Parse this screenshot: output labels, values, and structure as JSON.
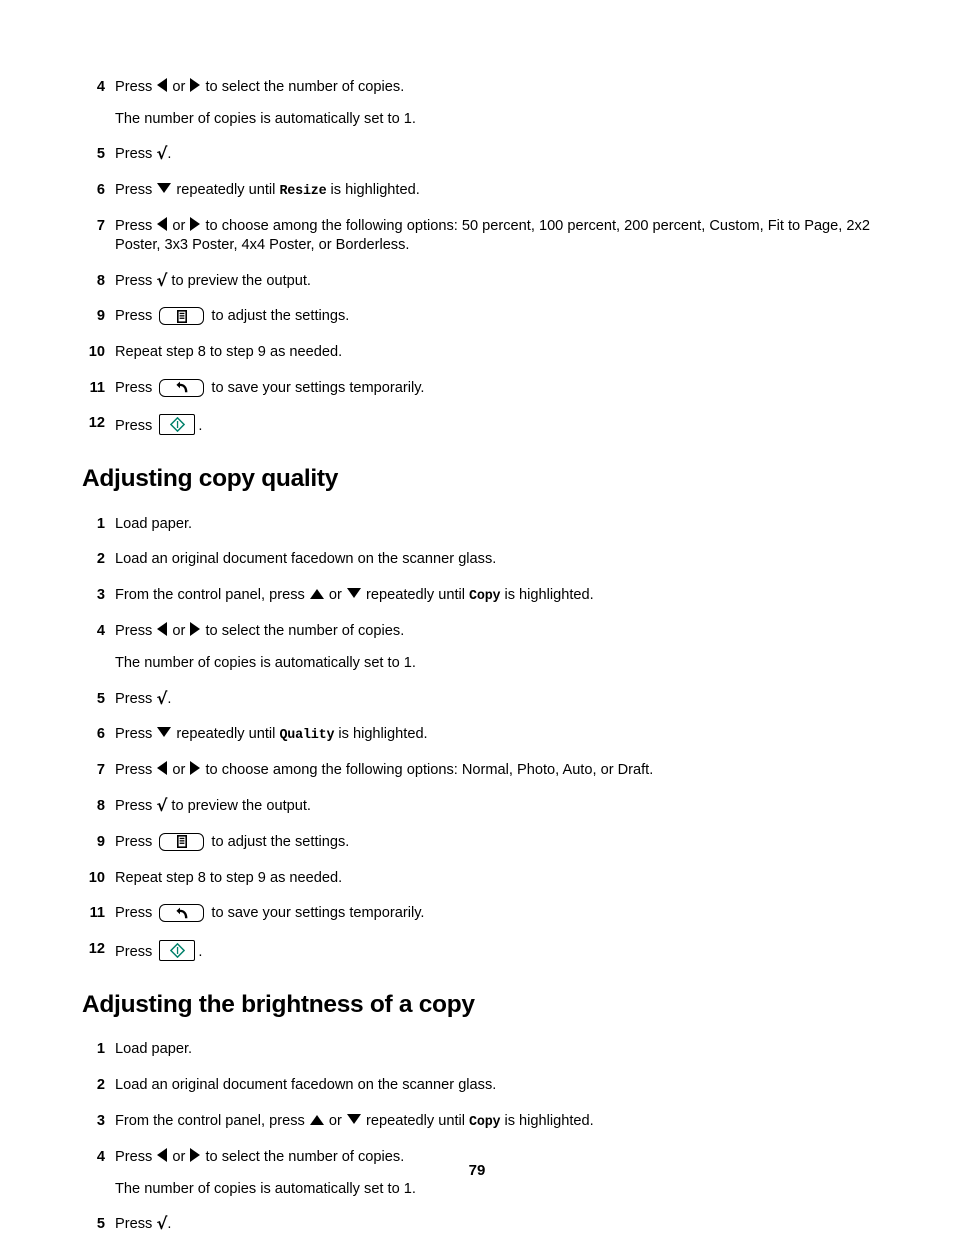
{
  "document": {
    "page_number": "79",
    "accent_color": "#00806a"
  },
  "icons": {
    "left_arrow": "left-triangle-icon",
    "right_arrow": "right-triangle-icon",
    "up_arrow": "up-triangle-icon",
    "down_arrow": "down-triangle-icon",
    "check": "check-icon",
    "settings_key": "settings-key-icon",
    "back_key": "back-key-icon",
    "start_key": "start-key-icon"
  },
  "sections": [
    {
      "id": "continued-steps",
      "heading": null,
      "steps": [
        {
          "num": "4",
          "parts": [
            {
              "t": "text",
              "v": "Press "
            },
            {
              "t": "icon",
              "v": "left_arrow"
            },
            {
              "t": "text",
              "v": " or "
            },
            {
              "t": "icon",
              "v": "right_arrow"
            },
            {
              "t": "text",
              "v": " to select the number of copies."
            }
          ],
          "note": "The number of copies is automatically set to 1."
        },
        {
          "num": "5",
          "parts": [
            {
              "t": "text",
              "v": "Press "
            },
            {
              "t": "icon",
              "v": "check"
            },
            {
              "t": "text",
              "v": "."
            }
          ]
        },
        {
          "num": "6",
          "parts": [
            {
              "t": "text",
              "v": "Press "
            },
            {
              "t": "icon",
              "v": "down_arrow"
            },
            {
              "t": "text",
              "v": " repeatedly until "
            },
            {
              "t": "mono",
              "v": "Resize"
            },
            {
              "t": "text",
              "v": " is highlighted."
            }
          ]
        },
        {
          "num": "7",
          "parts": [
            {
              "t": "text",
              "v": "Press "
            },
            {
              "t": "icon",
              "v": "left_arrow"
            },
            {
              "t": "text",
              "v": " or "
            },
            {
              "t": "icon",
              "v": "right_arrow"
            },
            {
              "t": "text",
              "v": " to choose among the following options: 50 percent, 100 percent, 200 percent, Custom, Fit to Page, 2x2 Poster, 3x3 Poster, 4x4 Poster, or Borderless."
            }
          ]
        },
        {
          "num": "8",
          "parts": [
            {
              "t": "text",
              "v": "Press "
            },
            {
              "t": "icon",
              "v": "check"
            },
            {
              "t": "text",
              "v": " to preview the output."
            }
          ]
        },
        {
          "num": "9",
          "parts": [
            {
              "t": "text",
              "v": "Press "
            },
            {
              "t": "key",
              "v": "settings_key"
            },
            {
              "t": "text",
              "v": " to adjust the settings."
            }
          ]
        },
        {
          "num": "10",
          "parts": [
            {
              "t": "text",
              "v": "Repeat step 8 to step 9 as needed."
            }
          ]
        },
        {
          "num": "11",
          "parts": [
            {
              "t": "text",
              "v": "Press "
            },
            {
              "t": "key",
              "v": "back_key"
            },
            {
              "t": "text",
              "v": " to save your settings temporarily."
            }
          ]
        },
        {
          "num": "12",
          "parts": [
            {
              "t": "text",
              "v": "Press "
            },
            {
              "t": "key",
              "v": "start_key"
            },
            {
              "t": "text",
              "v": "."
            }
          ]
        }
      ]
    },
    {
      "id": "adjusting-copy-quality",
      "heading": "Adjusting copy quality",
      "steps": [
        {
          "num": "1",
          "parts": [
            {
              "t": "text",
              "v": "Load paper."
            }
          ]
        },
        {
          "num": "2",
          "parts": [
            {
              "t": "text",
              "v": "Load an original document facedown on the scanner glass."
            }
          ]
        },
        {
          "num": "3",
          "parts": [
            {
              "t": "text",
              "v": "From the control panel, press "
            },
            {
              "t": "icon",
              "v": "up_arrow"
            },
            {
              "t": "text",
              "v": " or "
            },
            {
              "t": "icon",
              "v": "down_arrow"
            },
            {
              "t": "text",
              "v": " repeatedly until "
            },
            {
              "t": "mono",
              "v": "Copy"
            },
            {
              "t": "text",
              "v": " is highlighted."
            }
          ]
        },
        {
          "num": "4",
          "parts": [
            {
              "t": "text",
              "v": "Press "
            },
            {
              "t": "icon",
              "v": "left_arrow"
            },
            {
              "t": "text",
              "v": " or "
            },
            {
              "t": "icon",
              "v": "right_arrow"
            },
            {
              "t": "text",
              "v": " to select the number of copies."
            }
          ],
          "note": "The number of copies is automatically set to 1."
        },
        {
          "num": "5",
          "parts": [
            {
              "t": "text",
              "v": "Press "
            },
            {
              "t": "icon",
              "v": "check"
            },
            {
              "t": "text",
              "v": "."
            }
          ]
        },
        {
          "num": "6",
          "parts": [
            {
              "t": "text",
              "v": "Press "
            },
            {
              "t": "icon",
              "v": "down_arrow"
            },
            {
              "t": "text",
              "v": " repeatedly until "
            },
            {
              "t": "mono",
              "v": "Quality"
            },
            {
              "t": "text",
              "v": " is highlighted."
            }
          ]
        },
        {
          "num": "7",
          "parts": [
            {
              "t": "text",
              "v": "Press "
            },
            {
              "t": "icon",
              "v": "left_arrow"
            },
            {
              "t": "text",
              "v": " or "
            },
            {
              "t": "icon",
              "v": "right_arrow"
            },
            {
              "t": "text",
              "v": " to choose among the following options: Normal, Photo, Auto, or Draft."
            }
          ]
        },
        {
          "num": "8",
          "parts": [
            {
              "t": "text",
              "v": "Press "
            },
            {
              "t": "icon",
              "v": "check"
            },
            {
              "t": "text",
              "v": " to preview the output."
            }
          ]
        },
        {
          "num": "9",
          "parts": [
            {
              "t": "text",
              "v": "Press "
            },
            {
              "t": "key",
              "v": "settings_key"
            },
            {
              "t": "text",
              "v": " to adjust the settings."
            }
          ]
        },
        {
          "num": "10",
          "parts": [
            {
              "t": "text",
              "v": "Repeat step 8 to step 9 as needed."
            }
          ]
        },
        {
          "num": "11",
          "parts": [
            {
              "t": "text",
              "v": "Press "
            },
            {
              "t": "key",
              "v": "back_key"
            },
            {
              "t": "text",
              "v": " to save your settings temporarily."
            }
          ]
        },
        {
          "num": "12",
          "parts": [
            {
              "t": "text",
              "v": "Press "
            },
            {
              "t": "key",
              "v": "start_key"
            },
            {
              "t": "text",
              "v": "."
            }
          ]
        }
      ]
    },
    {
      "id": "adjusting-the-brightness-of-a-copy",
      "heading": "Adjusting the brightness of a copy",
      "steps": [
        {
          "num": "1",
          "parts": [
            {
              "t": "text",
              "v": "Load paper."
            }
          ]
        },
        {
          "num": "2",
          "parts": [
            {
              "t": "text",
              "v": "Load an original document facedown on the scanner glass."
            }
          ]
        },
        {
          "num": "3",
          "parts": [
            {
              "t": "text",
              "v": "From the control panel, press "
            },
            {
              "t": "icon",
              "v": "up_arrow"
            },
            {
              "t": "text",
              "v": " or "
            },
            {
              "t": "icon",
              "v": "down_arrow"
            },
            {
              "t": "text",
              "v": " repeatedly until "
            },
            {
              "t": "mono",
              "v": "Copy"
            },
            {
              "t": "text",
              "v": " is highlighted."
            }
          ]
        },
        {
          "num": "4",
          "parts": [
            {
              "t": "text",
              "v": "Press "
            },
            {
              "t": "icon",
              "v": "left_arrow"
            },
            {
              "t": "text",
              "v": " or "
            },
            {
              "t": "icon",
              "v": "right_arrow"
            },
            {
              "t": "text",
              "v": " to select the number of copies."
            }
          ],
          "note": "The number of copies is automatically set to 1."
        },
        {
          "num": "5",
          "parts": [
            {
              "t": "text",
              "v": "Press "
            },
            {
              "t": "icon",
              "v": "check"
            },
            {
              "t": "text",
              "v": "."
            }
          ]
        }
      ]
    }
  ]
}
